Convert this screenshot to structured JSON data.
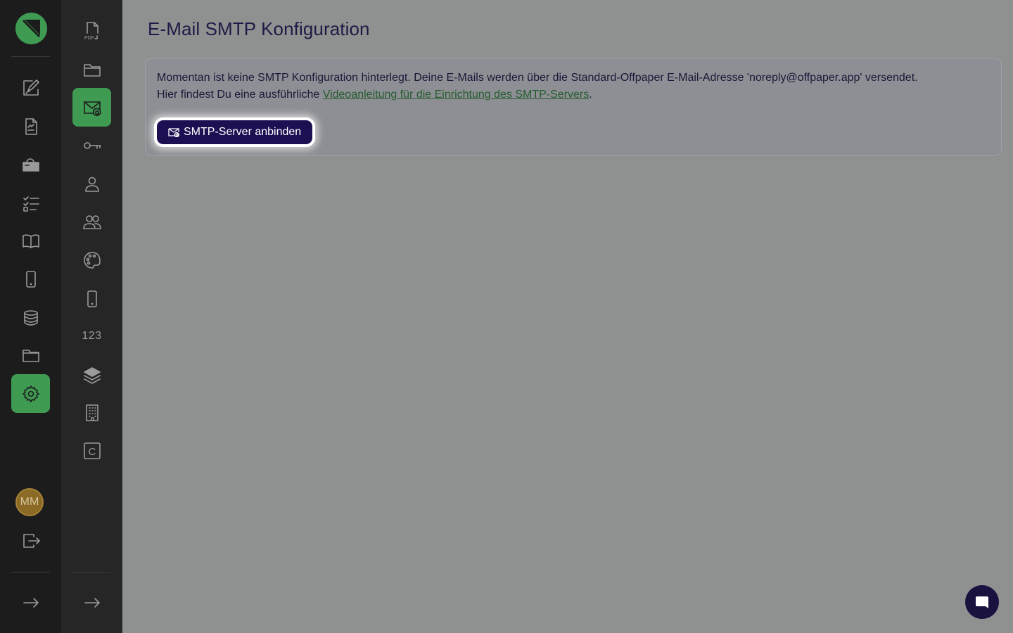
{
  "app": {
    "brand_color": "#3f9a52",
    "accent_dark": "#1e0e52"
  },
  "primary_nav": {
    "items": [
      {
        "icon": "edit-document-icon"
      },
      {
        "icon": "document-icon"
      },
      {
        "icon": "mailbox-icon"
      },
      {
        "icon": "checklist-icon"
      },
      {
        "icon": "book-icon"
      },
      {
        "icon": "phone-icon"
      },
      {
        "icon": "database-icon"
      },
      {
        "icon": "folder-icon"
      },
      {
        "icon": "gear-icon",
        "active": true
      }
    ],
    "avatar_initials": "MM",
    "logout_icon": "logout-icon",
    "expand_icon": "arrow-right-icon"
  },
  "secondary_nav": {
    "items": [
      {
        "icon": "pdf-icon",
        "label": "PDF"
      },
      {
        "icon": "folder-icon"
      },
      {
        "icon": "email-at-icon",
        "active": true
      },
      {
        "icon": "key-icon"
      },
      {
        "icon": "user-icon"
      },
      {
        "icon": "users-icon"
      },
      {
        "icon": "palette-icon"
      },
      {
        "icon": "phone-icon"
      },
      {
        "icon": "numbers-icon",
        "label": "123"
      },
      {
        "icon": "layers-icon"
      },
      {
        "icon": "building-icon"
      },
      {
        "icon": "letter-c-icon",
        "label": "C"
      }
    ],
    "expand_icon": "arrow-right-icon"
  },
  "main": {
    "title": "E-Mail SMTP Konfiguration",
    "info_line1": "Momentan ist keine SMTP Konfiguration hinterlegt. Deine E-Mails werden über die Standard-Offpaper E-Mail-Adresse 'noreply@offpaper.app' versendet.",
    "info_line2_prefix": "Hier findest Du eine ausführliche ",
    "info_line2_link": "Videoanleitung für die Einrichtung des SMTP-Servers",
    "info_line2_suffix": ".",
    "connect_button": "SMTP-Server anbinden"
  },
  "chat": {
    "icon": "chat-icon"
  }
}
